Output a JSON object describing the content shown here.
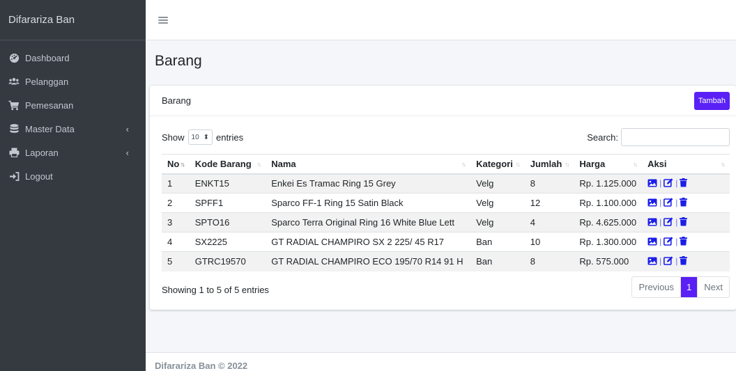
{
  "brand": "Difarariza Ban",
  "sidebar": {
    "items": [
      {
        "label": "Dashboard",
        "icon": "tachometer-icon",
        "has_chevron": false
      },
      {
        "label": "Pelanggan",
        "icon": "users-icon",
        "has_chevron": false
      },
      {
        "label": "Pemesanan",
        "icon": "cart-icon",
        "has_chevron": false
      },
      {
        "label": "Master Data",
        "icon": "database-icon",
        "has_chevron": true
      },
      {
        "label": "Laporan",
        "icon": "print-icon",
        "has_chevron": true
      },
      {
        "label": "Logout",
        "icon": "sign-out-icon",
        "has_chevron": false
      }
    ]
  },
  "page": {
    "title": "Barang"
  },
  "card": {
    "title": "Barang",
    "add_label": "Tambah"
  },
  "table_controls": {
    "show_label": "Show",
    "page_size": "10",
    "entries_label": "entries",
    "search_label": "Search:",
    "search_value": ""
  },
  "table": {
    "columns": [
      "No",
      "Kode Barang",
      "Nama",
      "Kategori",
      "Jumlah",
      "Harga",
      "Aksi"
    ],
    "rows": [
      {
        "no": "1",
        "kode": "ENKT15",
        "nama": "Enkei Es Tramac Ring 15 Grey",
        "kategori": "Velg",
        "jumlah": "8",
        "harga": "Rp. 1.125.000"
      },
      {
        "no": "2",
        "kode": "SPFF1",
        "nama": "Sparco FF-1 Ring 15 Satin Black",
        "kategori": "Velg",
        "jumlah": "12",
        "harga": "Rp. 1.100.000"
      },
      {
        "no": "3",
        "kode": "SPTO16",
        "nama": "Sparco Terra Original Ring 16 White Blue Lett",
        "kategori": "Velg",
        "jumlah": "4",
        "harga": "Rp. 4.625.000"
      },
      {
        "no": "4",
        "kode": "SX2225",
        "nama": "GT RADIAL CHAMPIRO SX 2 225/ 45 R17",
        "kategori": "Ban",
        "jumlah": "10",
        "harga": "Rp. 1.300.000"
      },
      {
        "no": "5",
        "kode": "GTRC19570",
        "nama": "GT RADIAL CHAMPIRO ECO 195/70 R14 91 H",
        "kategori": "Ban",
        "jumlah": "8",
        "harga": "Rp. 575.000"
      }
    ]
  },
  "table_footer": {
    "info": "Showing 1 to 5 of 5 entries",
    "prev_label": "Previous",
    "current_page": "1",
    "next_label": "Next"
  },
  "footer": {
    "text": "Difarariza Ban © 2022"
  },
  "colors": {
    "primary": "#5a20f5",
    "sidebar_bg": "#343a40",
    "action_icon": "#1b1ee8"
  }
}
